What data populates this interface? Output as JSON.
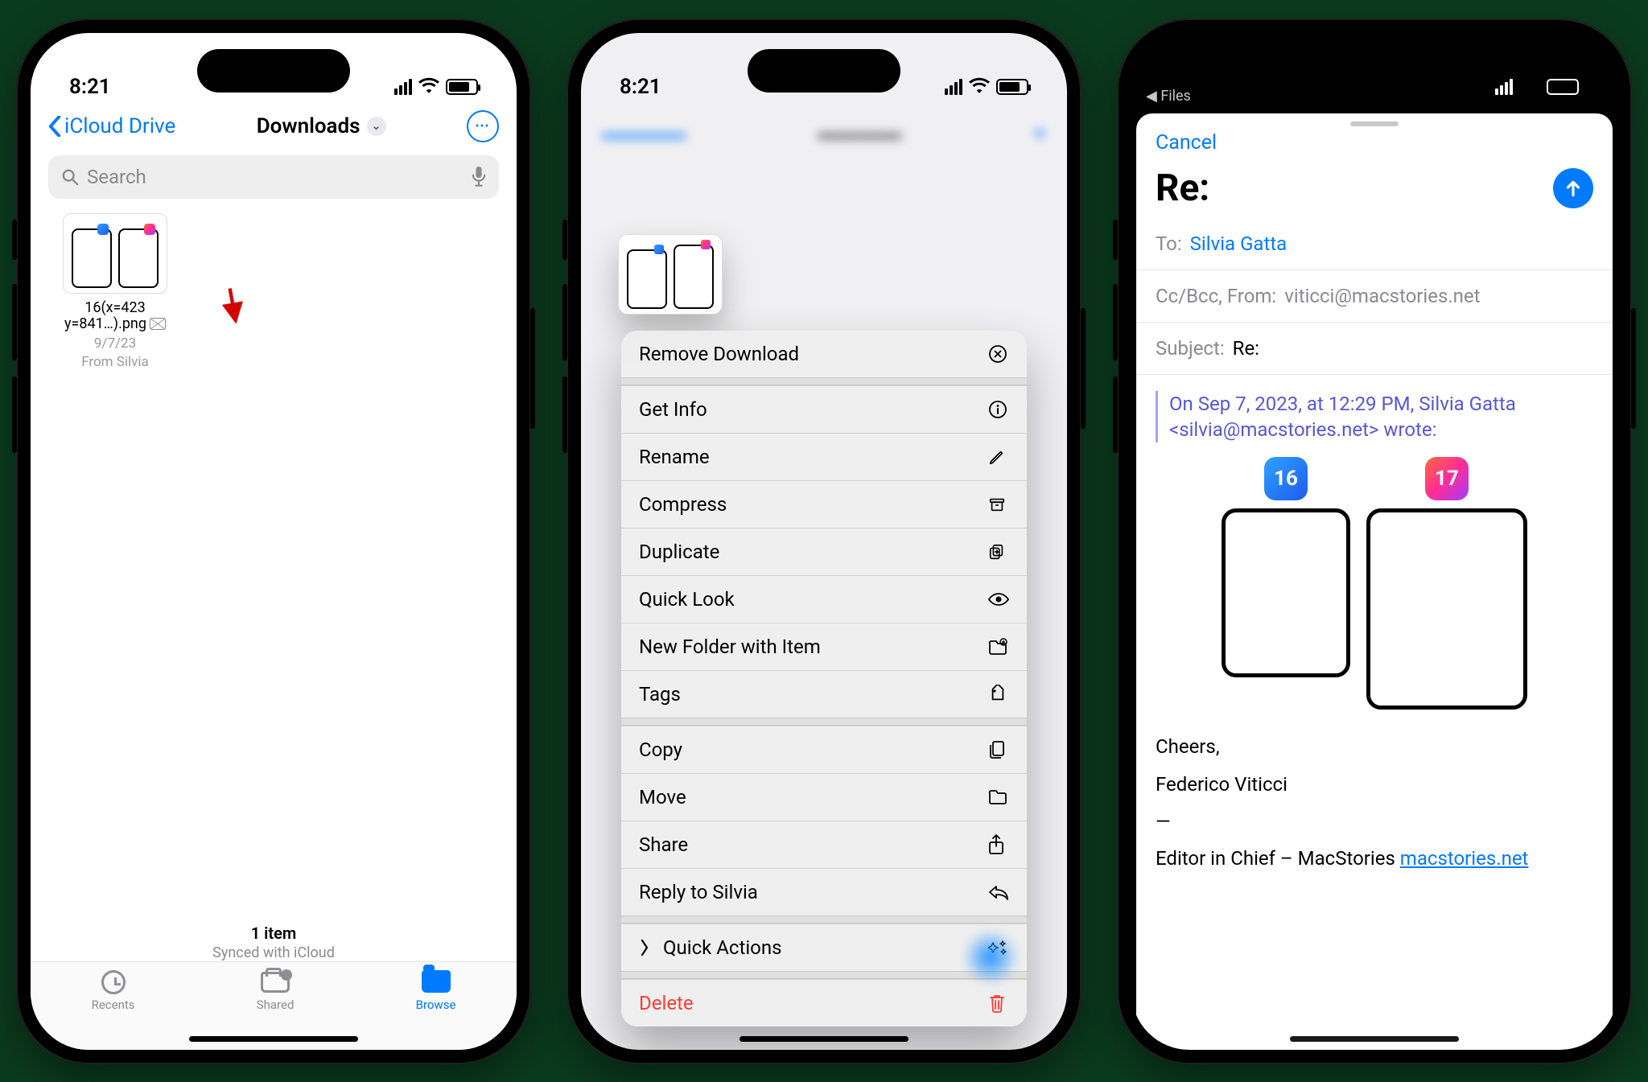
{
  "status": {
    "time": "8:21",
    "time3": "8:21"
  },
  "back_app": "Files",
  "p1": {
    "back": "iCloud Drive",
    "title": "Downloads",
    "search_placeholder": "Search",
    "file": {
      "name_l1": "16(x=423",
      "name_l2": "y=841…).png",
      "date": "9/7/23",
      "from": "From Silvia"
    },
    "footer_count": "1 item",
    "footer_sync": "Synced with iCloud",
    "tabs": {
      "recents": "Recents",
      "shared": "Shared",
      "browse": "Browse"
    }
  },
  "p2": {
    "menu": {
      "remove": "Remove Download",
      "info": "Get Info",
      "rename": "Rename",
      "compress": "Compress",
      "duplicate": "Duplicate",
      "quicklook": "Quick Look",
      "newfolder": "New Folder with Item",
      "tags": "Tags",
      "copy": "Copy",
      "move": "Move",
      "share": "Share",
      "reply": "Reply to Silvia",
      "quickactions": "Quick Actions",
      "delete": "Delete"
    }
  },
  "p3": {
    "cancel": "Cancel",
    "subject_title": "Re:",
    "to_label": "To:",
    "to_value": "Silvia Gatta",
    "cc_label": "Cc/Bcc, From:",
    "cc_value": "viticci@macstories.net",
    "subj_label": "Subject:",
    "subj_value": "Re:",
    "quote": "On Sep 7, 2023, at 12:29 PM, Silvia Gatta <silvia@macstories.net> wrote:",
    "badge16": "16",
    "badge17": "17",
    "sig1": "Cheers,",
    "sig2": "Federico Viticci",
    "sig3": "—",
    "sig4a": "Editor in Chief – MacStories ",
    "sig4b": "macstories.net"
  }
}
